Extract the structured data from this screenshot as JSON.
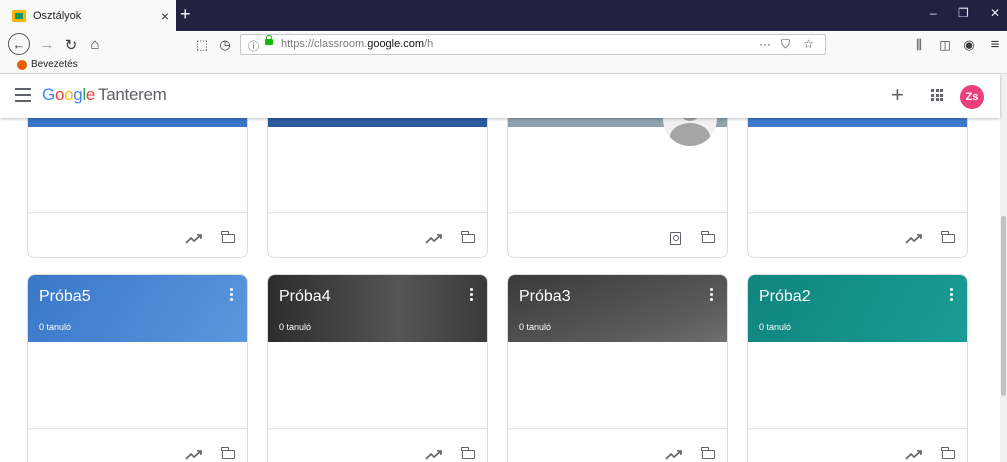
{
  "browser": {
    "tab_title": "Osztályok",
    "tab_close": "×",
    "new_tab": "+",
    "url_prefix": "https://classroom.",
    "url_domain": "google.com",
    "url_suffix": "/h",
    "bookmark_label": "Bevezetés",
    "window_controls": [
      "–",
      "❐",
      "✕"
    ]
  },
  "app": {
    "logo_google": [
      "G",
      "o",
      "o",
      "g",
      "l",
      "e"
    ],
    "product_name": "Tanterem",
    "avatar_initials": "Zs",
    "add_symbol": "+"
  },
  "top_cards": [
    {
      "strip_color": "#3a74c6",
      "footer_icons": [
        "trend-icon",
        "folder-icon"
      ]
    },
    {
      "strip_color": "#2c5aa0",
      "footer_icons": [
        "trend-icon",
        "folder-icon"
      ]
    },
    {
      "strip_color": "#8fa2ad",
      "footer_icons": [
        "badge-icon",
        "folder-icon"
      ],
      "has_profile": true
    },
    {
      "strip_color": "#3c79c9",
      "footer_icons": [
        "trend-icon",
        "folder-icon"
      ]
    }
  ],
  "courses": [
    {
      "name": "Próba5",
      "students": "0 tanuló",
      "theme": "#3a77c7"
    },
    {
      "name": "Próba4",
      "students": "0 tanuló",
      "theme": "#3e3e3e"
    },
    {
      "name": "Próba3",
      "students": "0 tanuló",
      "theme": "#454545"
    },
    {
      "name": "Próba2",
      "students": "0 tanuló",
      "theme": "#118a83"
    }
  ]
}
